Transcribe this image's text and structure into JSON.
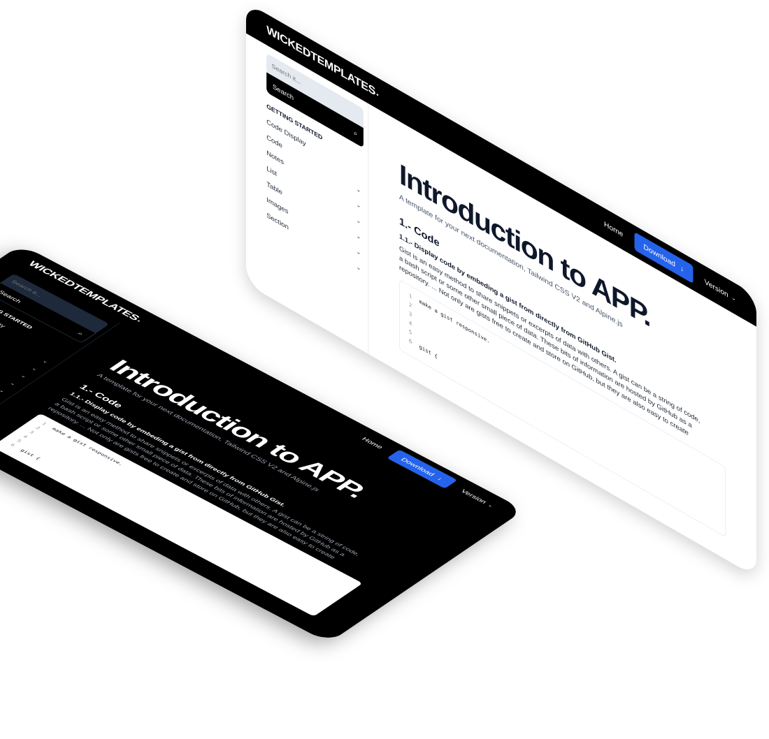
{
  "brand": {
    "logo": "WICKEDTEMPLATES",
    "logo_mark": "•"
  },
  "nav": {
    "home": "Home",
    "download": "Download",
    "download_icon": "↓",
    "version": "Version",
    "chevron": "⌄"
  },
  "sidebar": {
    "search_placeholder": "Search it...",
    "search_button": "Search",
    "search_icon": "⌕",
    "section_title": "GETTING STARTED",
    "items": [
      {
        "label": "Code Display",
        "chevron": ""
      },
      {
        "label": "Code",
        "chevron": "⌄"
      },
      {
        "label": "Notes",
        "chevron": "⌄"
      },
      {
        "label": "List",
        "chevron": "⌄"
      },
      {
        "label": "Table",
        "chevron": "⌄"
      },
      {
        "label": "Images",
        "chevron": "⌄"
      },
      {
        "label": "Section",
        "chevron": "⌄"
      }
    ]
  },
  "content": {
    "title": "Introduction to APP.",
    "subtitle": "A template for your next documentation, Tailwind CSS V2 and Alpine.js",
    "section_heading": "1.- Code",
    "subsection_heading": "1.1.- Display code by embeding a gist from directly from GitHub Gist.",
    "paragraph": "Gist is an easy method to share snippets or excerpts of data with others. A gist can be a string of code, a bash script or some other small piece of data. These bits of information are hosted by GitHub as a repository. ... Not only are gists free to create and store on GitHub, but they are also easy to create",
    "code_lines": [
      {
        "n": "1",
        "text": "make a gist responsive."
      },
      {
        "n": "2",
        "text": ""
      },
      {
        "n": "3",
        "text": ""
      },
      {
        "n": "4",
        "text": ""
      },
      {
        "n": "5",
        "text": ""
      },
      {
        "n": "6",
        "text": "gist {"
      }
    ]
  },
  "colors": {
    "accent": "#2563eb",
    "dark_bg": "#000000",
    "light_bg": "#ffffff",
    "search_bg_light": "#e5e9f0",
    "search_bg_dark": "#1e293b"
  }
}
